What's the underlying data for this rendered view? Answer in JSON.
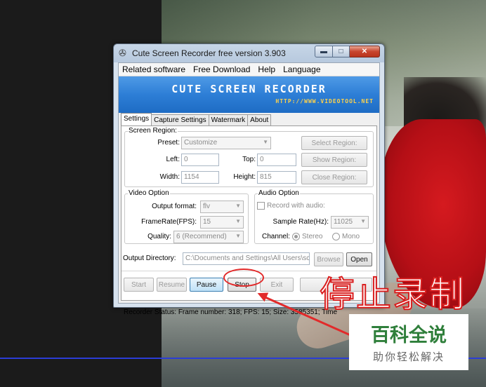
{
  "window": {
    "title": "Cute Screen Recorder free version 3.903",
    "min_glyph": "▬",
    "max_glyph": "□",
    "close_glyph": "✕"
  },
  "menu": [
    "Related software",
    "Free Download",
    "Help",
    "Language"
  ],
  "banner": {
    "title": "CUTE SCREEN RECORDER",
    "url": "HTTP://WWW.VIDEOTOOL.NET"
  },
  "tabs": [
    "Settings",
    "Capture Settings",
    "Watermark",
    "About"
  ],
  "active_tab": "Settings",
  "screen_region": {
    "group_label": "Screen Region:",
    "preset_label": "Preset:",
    "preset_value": "Customize",
    "select_region_button": "Select Region:",
    "left_label": "Left:",
    "left_value": "0",
    "top_label": "Top:",
    "top_value": "0",
    "show_region_button": "Show Region:",
    "width_label": "Width:",
    "width_value": "1154",
    "height_label": "Height:",
    "height_value": "815",
    "close_region_button": "Close Region:"
  },
  "video_option": {
    "group_label": "Video Option",
    "format_label": "Output format:",
    "format_value": "flv",
    "fps_label": "FrameRate(FPS):",
    "fps_value": "15",
    "quality_label": "Quality:",
    "quality_value": "6 (Recommend)"
  },
  "audio_option": {
    "group_label": "Audio Option",
    "record_label": "Record with audio:",
    "record_checked": false,
    "sample_rate_label": "Sample Rate(Hz):",
    "sample_rate_value": "11025",
    "channel_label": "Channel:",
    "stereo_label": "Stereo",
    "mono_label": "Mono",
    "channel_selected": "Stereo"
  },
  "output": {
    "label": "Output Directory:",
    "path": "C:\\Documents and Settings\\All Users\\scre",
    "browse_button": "Browse",
    "open_button": "Open"
  },
  "controls": {
    "start": "Start",
    "resume": "Resume",
    "pause": "Pause",
    "stop": "Stop",
    "exit": "Exit"
  },
  "status": "Recorder Status: Frame number: 318; FPS: 15; Size: 3585351; Time",
  "annotation": {
    "text": "停止录制",
    "color": "#e22a2a"
  },
  "watermark": {
    "title": "百科全说",
    "subtitle": "助你轻松解决"
  },
  "colors": {
    "banner_blue": "#2d7ed6",
    "banner_url": "#ffd24a",
    "annotation_red": "#e22a2a",
    "watermark_green": "#2f7f3b"
  }
}
